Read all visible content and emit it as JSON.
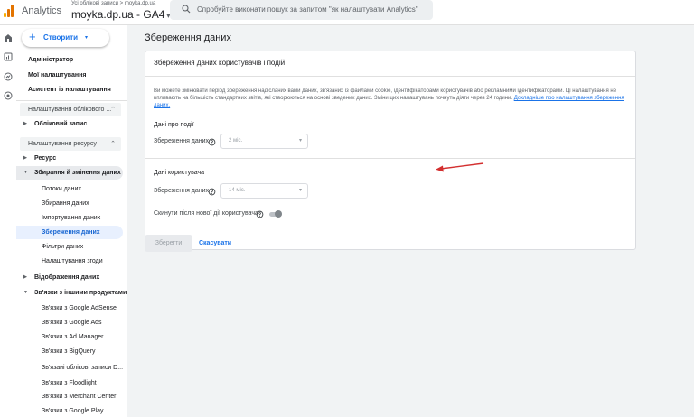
{
  "header": {
    "app_name": "Analytics",
    "breadcrumb": "Усі облікові записи > moyka.dp.ua",
    "property_title": "moyka.dp.ua - GA4",
    "property_caret": "▾",
    "search_placeholder": "Спробуйте виконати пошук за запитом \"як налаштувати Analytics\""
  },
  "sidebar": {
    "create_label": "Створити",
    "create_plus": "+",
    "create_caret": "▾",
    "top_items": [
      "Адміністратор",
      "Мої налаштування",
      "Асистент із налаштування"
    ],
    "account_section": "Налаштування облікового ...",
    "account_item": "Обліковий запис",
    "resource_section": "Налаштування ресурсу",
    "resource_item": "Ресурс",
    "collection_group": "Збирання й змінення даних",
    "collection_children": [
      "Потоки даних",
      "Збирання даних",
      "Імпортування даних",
      "Збереження даних",
      "Фільтри даних",
      "Налаштування згоди"
    ],
    "display_item": "Відображення даних",
    "links_group": "Зв'язки з іншими продуктами",
    "links_children": [
      "Зв'язки з Google AdSense",
      "Зв'язки з Google Ads",
      "Зв'язки з Ad Manager",
      "Зв'язки з BigQuery",
      "Зв'язані облікові записи D...",
      "Зв'язки з Floodlight",
      "Зв'язки з Merchant Center",
      "Зв'язки з Google Play"
    ]
  },
  "main": {
    "page_title": "Збереження даних",
    "card_title": "Збереження даних користувачів і подій",
    "description": "Ви можете змінювати період збереження надісланих вами даних, зв'язаних із файлами cookie, ідентифікаторами користувачів або рекламними ідентифікаторами. Ці налаштування не впливають на більшість стандартних звітів, які створюються на основі зведених даних. Зміни цих налаштувань почнуть діяти через 24 години.",
    "learn_more": "Докладніше про налаштування збереження даних.",
    "event_section": "Дані про події",
    "event_field_label": "Збереження даних",
    "event_field_value": "2 міс.",
    "user_section": "Дані користувача",
    "user_field_label": "Збереження даних",
    "user_field_value": "14 міс.",
    "reset_label": "Скинути після нової дії користувача",
    "reset_enabled": true,
    "save_label": "Зберегти",
    "cancel_label": "Скасувати",
    "select_caret": "▾"
  },
  "colors": {
    "accent": "#1a73e8",
    "annotation_arrow": "#d32f2f"
  }
}
